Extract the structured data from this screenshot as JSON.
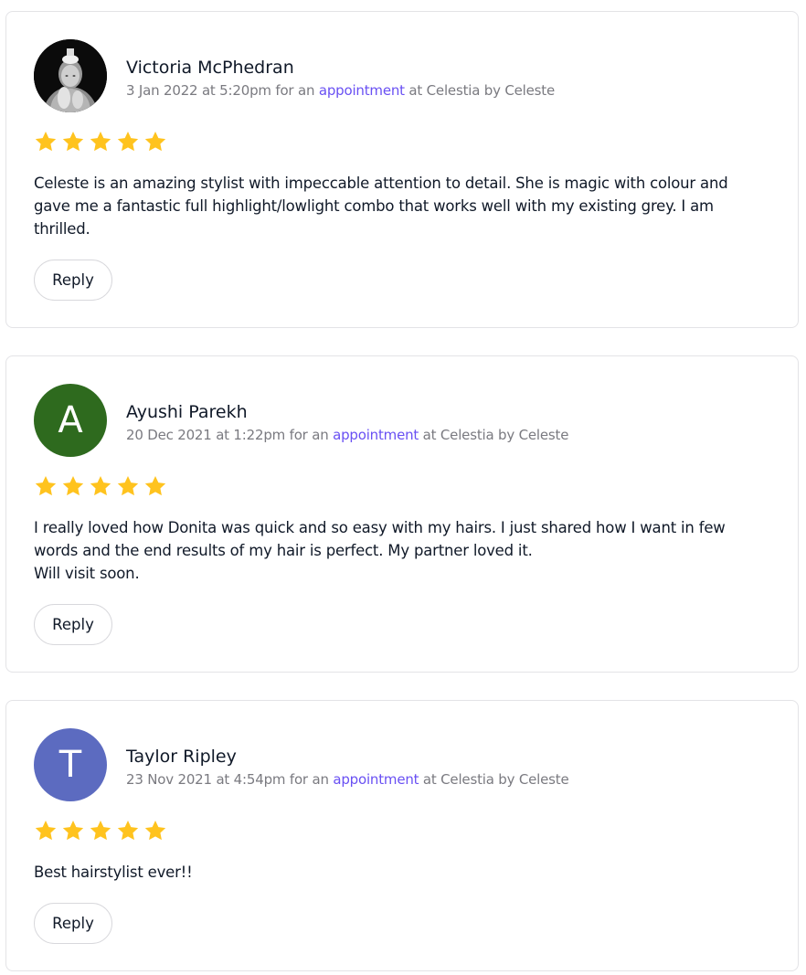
{
  "reviews": [
    {
      "name": "Victoria McPhedran",
      "meta_prefix": "3 Jan 2022 at 5:20pm for an",
      "meta_link": "appointment",
      "meta_suffix": "at Celestia by Celeste",
      "avatar_type": "photo",
      "avatar_letter": "",
      "avatar_color": "#000000",
      "rating": 5,
      "text_lines": [
        "Celeste is an amazing stylist with impeccable attention to detail. She is magic with colour and",
        "gave me a fantastic full highlight/lowlight combo that works well with my existing grey. I am",
        "thrilled."
      ],
      "reply_label": "Reply"
    },
    {
      "name": "Ayushi Parekh",
      "meta_prefix": "20 Dec 2021 at 1:22pm for an",
      "meta_link": "appointment",
      "meta_suffix": "at Celestia by Celeste",
      "avatar_type": "letter",
      "avatar_letter": "A",
      "avatar_color": "#2e6a1e",
      "rating": 5,
      "text_lines": [
        "I really loved how Donita was quick and so easy with my hairs. I just shared how I want in few",
        "words and the end results of my hair is perfect. My partner loved it.",
        "Will visit soon."
      ],
      "reply_label": "Reply"
    },
    {
      "name": "Taylor Ripley",
      "meta_prefix": "23 Nov 2021 at 4:54pm for an",
      "meta_link": "appointment",
      "meta_suffix": "at Celestia by Celeste",
      "avatar_type": "letter",
      "avatar_letter": "T",
      "avatar_color": "#5c6bc0",
      "rating": 5,
      "text_lines": [
        "Best hairstylist ever!!"
      ],
      "reply_label": "Reply"
    }
  ],
  "colors": {
    "star": "#ffc31e",
    "link": "#6950f3",
    "meta": "#7a7a80"
  },
  "icons": {
    "star": "star-icon",
    "photo": "portrait-photo"
  }
}
